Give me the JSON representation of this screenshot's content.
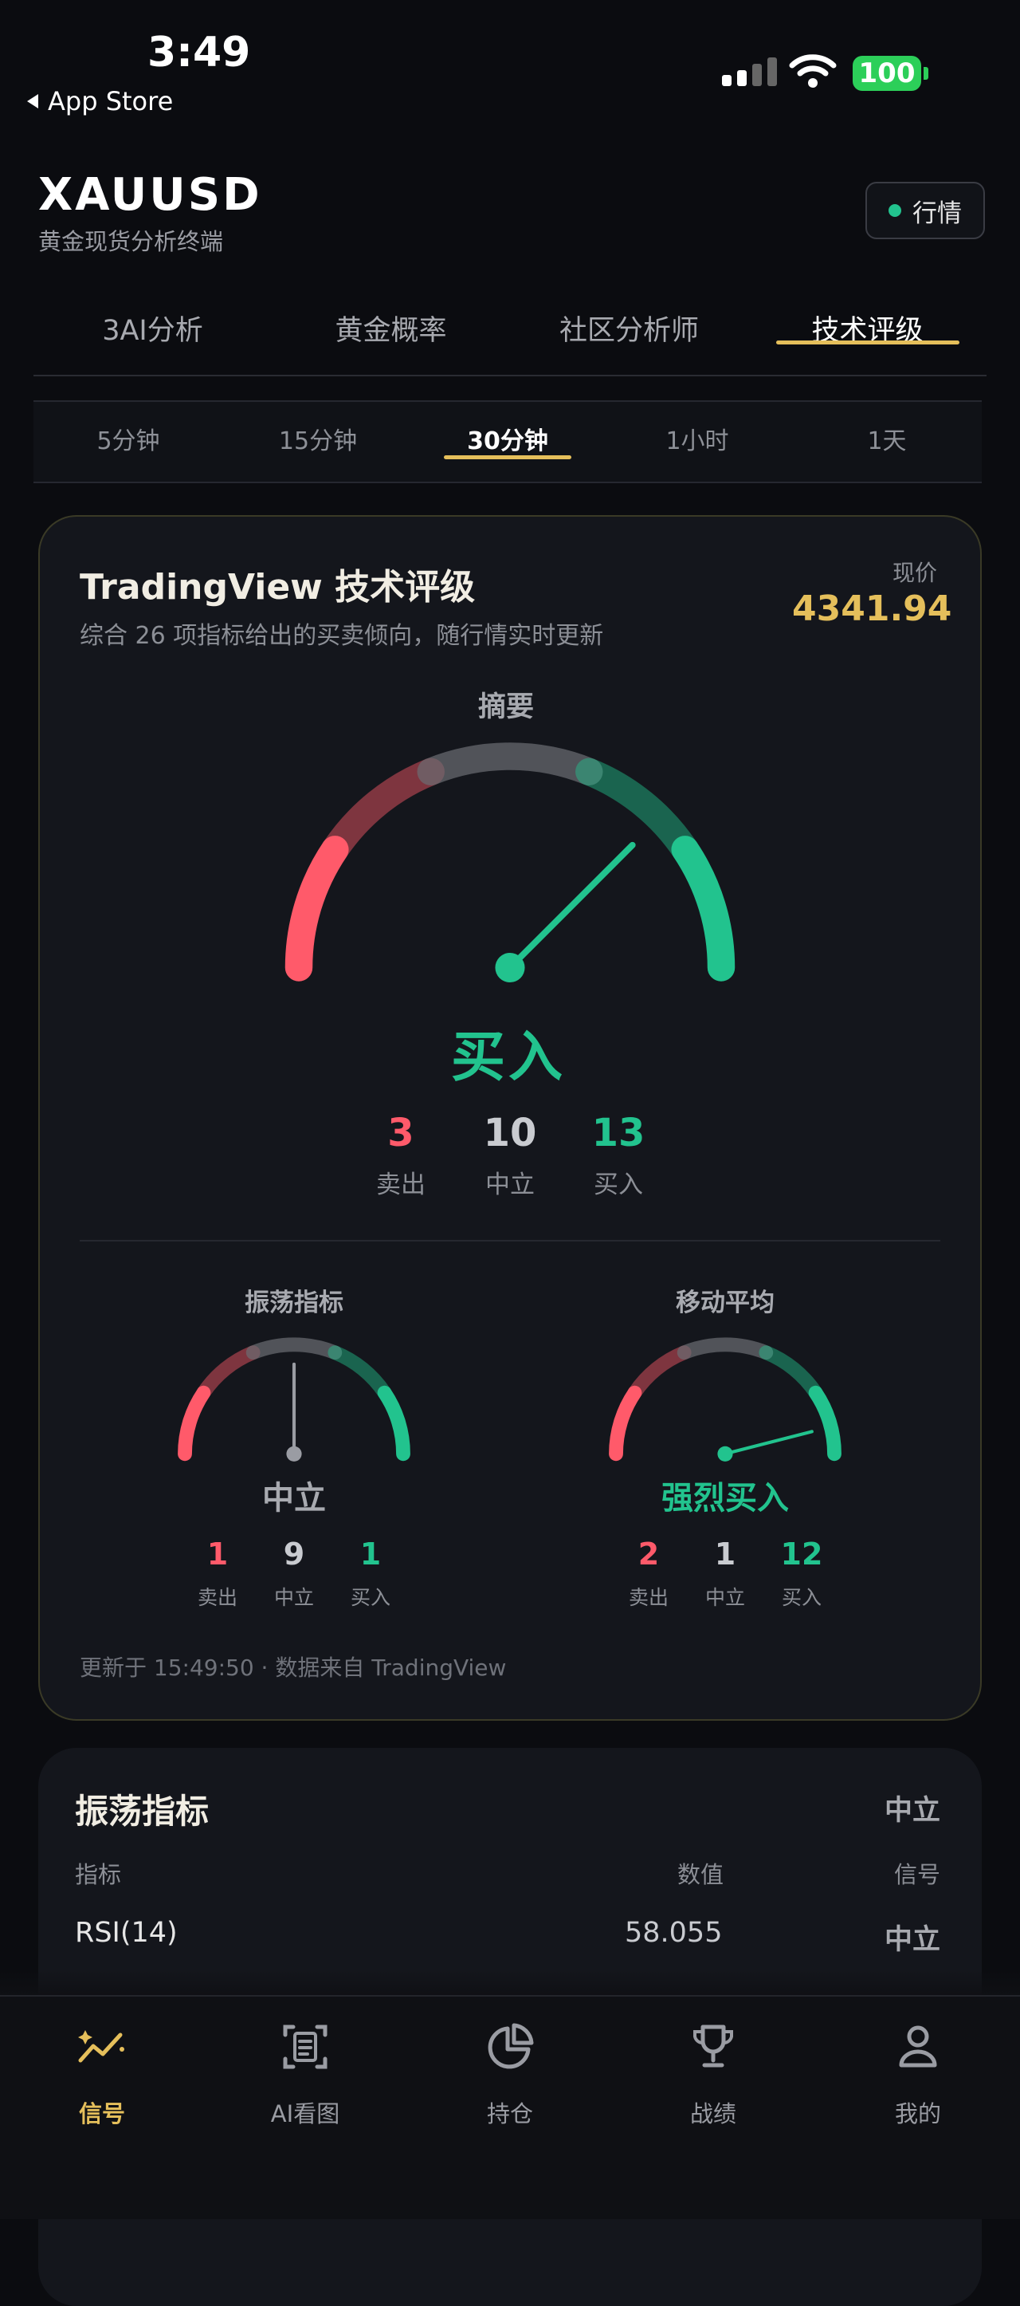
{
  "status_bar": {
    "time": "3:49",
    "back_label": "App Store",
    "battery": "100"
  },
  "header": {
    "ticker": "XAUUSD",
    "subtitle": "黄金现货分析终端",
    "market_button": "行情"
  },
  "tabs": [
    {
      "label": "3AI分析",
      "active": false
    },
    {
      "label": "黄金概率",
      "active": false
    },
    {
      "label": "社区分析师",
      "active": false
    },
    {
      "label": "技术评级",
      "active": true
    }
  ],
  "timeframes": [
    {
      "label": "5分钟",
      "active": false
    },
    {
      "label": "15分钟",
      "active": false
    },
    {
      "label": "30分钟",
      "active": true
    },
    {
      "label": "1小时",
      "active": false
    },
    {
      "label": "1天",
      "active": false
    }
  ],
  "rating_card": {
    "title": "TradingView 技术评级",
    "description": "综合 26 项指标给出的买卖倾向，随行情实时更新",
    "price_label": "现价",
    "price": "4341.94",
    "summary": {
      "label": "摘要",
      "verdict": "买入",
      "sell": "3",
      "neutral": "10",
      "buy": "13",
      "sell_label": "卖出",
      "neutral_label": "中立",
      "buy_label": "买入",
      "needle_level": 0.75
    },
    "oscillators": {
      "label": "振荡指标",
      "verdict": "中立",
      "sell": "1",
      "neutral": "9",
      "buy": "1",
      "sell_label": "卖出",
      "neutral_label": "中立",
      "buy_label": "买入",
      "needle_level": 0.5
    },
    "moving_averages": {
      "label": "移动平均",
      "verdict": "强烈买入",
      "sell": "2",
      "neutral": "1",
      "buy": "12",
      "sell_label": "卖出",
      "neutral_label": "中立",
      "buy_label": "买入",
      "needle_level": 0.92
    },
    "footer": "更新于 15:49:50 · 数据来自 TradingView"
  },
  "oscillator_table": {
    "title": "振荡指标",
    "status": "中立",
    "columns": [
      "指标",
      "数值",
      "信号"
    ],
    "rows": [
      {
        "name": "RSI(14)",
        "value": "58.055",
        "signal": "中立"
      }
    ]
  },
  "bottom_nav": [
    {
      "label": "信号",
      "icon": "signal-chart-icon",
      "active": true
    },
    {
      "label": "AI看图",
      "icon": "scan-document-icon",
      "active": false
    },
    {
      "label": "持仓",
      "icon": "pie-chart-icon",
      "active": false
    },
    {
      "label": "战绩",
      "icon": "trophy-icon",
      "active": false
    },
    {
      "label": "我的",
      "icon": "user-icon",
      "active": false
    }
  ],
  "colors": {
    "sell": "#ff5a6a",
    "neutral": "#a8aab0",
    "buy": "#22c38e",
    "accent": "#e5bf5b"
  }
}
